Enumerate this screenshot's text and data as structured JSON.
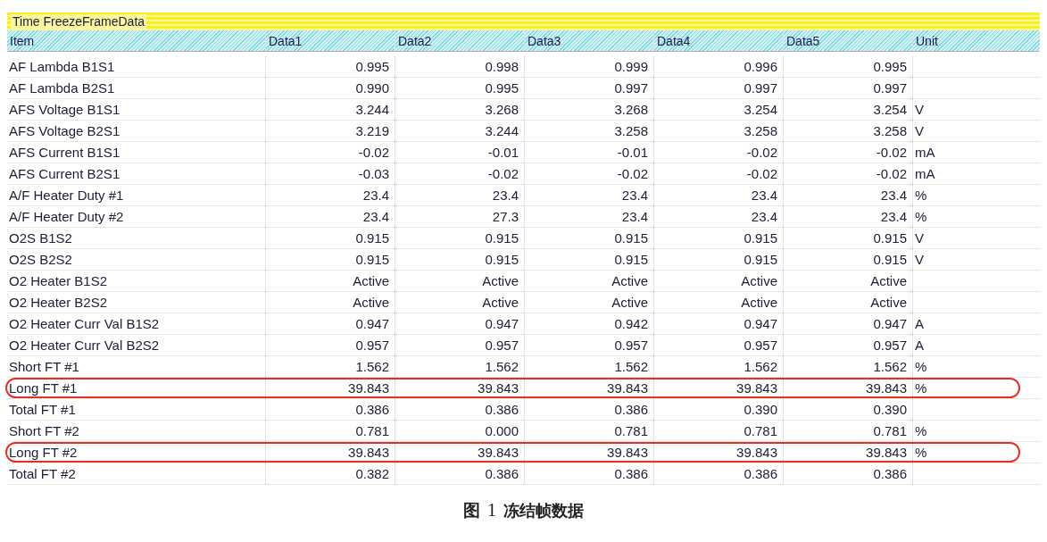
{
  "panel": {
    "title": "Time FreezeFrameData"
  },
  "table": {
    "columns": [
      "Item",
      "Data1",
      "Data2",
      "Data3",
      "Data4",
      "Data5",
      "Unit"
    ],
    "rows": [
      {
        "cells": [
          "AF Lambda B1S1",
          "0.995",
          "0.998",
          "0.999",
          "0.996",
          "0.995",
          ""
        ],
        "highlighted": false
      },
      {
        "cells": [
          "AF Lambda B2S1",
          "0.990",
          "0.995",
          "0.997",
          "0.997",
          "0.997",
          ""
        ],
        "highlighted": false
      },
      {
        "cells": [
          "AFS Voltage B1S1",
          "3.244",
          "3.268",
          "3.268",
          "3.254",
          "3.254",
          "V"
        ],
        "highlighted": false
      },
      {
        "cells": [
          "AFS Voltage B2S1",
          "3.219",
          "3.244",
          "3.258",
          "3.258",
          "3.258",
          "V"
        ],
        "highlighted": false
      },
      {
        "cells": [
          "AFS Current B1S1",
          "-0.02",
          "-0.01",
          "-0.01",
          "-0.02",
          "-0.02",
          "mA"
        ],
        "highlighted": false
      },
      {
        "cells": [
          "AFS Current B2S1",
          "-0.03",
          "-0.02",
          "-0.02",
          "-0.02",
          "-0.02",
          "mA"
        ],
        "highlighted": false
      },
      {
        "cells": [
          "A/F Heater Duty #1",
          "23.4",
          "23.4",
          "23.4",
          "23.4",
          "23.4",
          "%"
        ],
        "highlighted": false
      },
      {
        "cells": [
          "A/F Heater Duty #2",
          "23.4",
          "27.3",
          "23.4",
          "23.4",
          "23.4",
          "%"
        ],
        "highlighted": false
      },
      {
        "cells": [
          "O2S B1S2",
          "0.915",
          "0.915",
          "0.915",
          "0.915",
          "0.915",
          "V"
        ],
        "highlighted": false
      },
      {
        "cells": [
          "O2S B2S2",
          "0.915",
          "0.915",
          "0.915",
          "0.915",
          "0.915",
          "V"
        ],
        "highlighted": false
      },
      {
        "cells": [
          "O2 Heater B1S2",
          "Active",
          "Active",
          "Active",
          "Active",
          "Active",
          ""
        ],
        "highlighted": false
      },
      {
        "cells": [
          "O2 Heater B2S2",
          "Active",
          "Active",
          "Active",
          "Active",
          "Active",
          ""
        ],
        "highlighted": false
      },
      {
        "cells": [
          "O2 Heater Curr Val B1S2",
          "0.947",
          "0.947",
          "0.942",
          "0.947",
          "0.947",
          "A"
        ],
        "highlighted": false
      },
      {
        "cells": [
          "O2 Heater Curr Val B2S2",
          "0.957",
          "0.957",
          "0.957",
          "0.957",
          "0.957",
          "A"
        ],
        "highlighted": false
      },
      {
        "cells": [
          "Short FT #1",
          "1.562",
          "1.562",
          "1.562",
          "1.562",
          "1.562",
          "%"
        ],
        "highlighted": false
      },
      {
        "cells": [
          "Long FT #1",
          "39.843",
          "39.843",
          "39.843",
          "39.843",
          "39.843",
          "%"
        ],
        "highlighted": true
      },
      {
        "cells": [
          "Total FT #1",
          "0.386",
          "0.386",
          "0.386",
          "0.390",
          "0.390",
          ""
        ],
        "highlighted": false
      },
      {
        "cells": [
          "Short FT #2",
          "0.781",
          "0.000",
          "0.781",
          "0.781",
          "0.781",
          "%"
        ],
        "highlighted": false
      },
      {
        "cells": [
          "Long FT #2",
          "39.843",
          "39.843",
          "39.843",
          "39.843",
          "39.843",
          "%"
        ],
        "highlighted": true
      },
      {
        "cells": [
          "Total FT #2",
          "0.382",
          "0.386",
          "0.386",
          "0.386",
          "0.386",
          ""
        ],
        "highlighted": false
      }
    ]
  },
  "caption": {
    "label": "图",
    "number": "1",
    "title": "冻结帧数据"
  }
}
